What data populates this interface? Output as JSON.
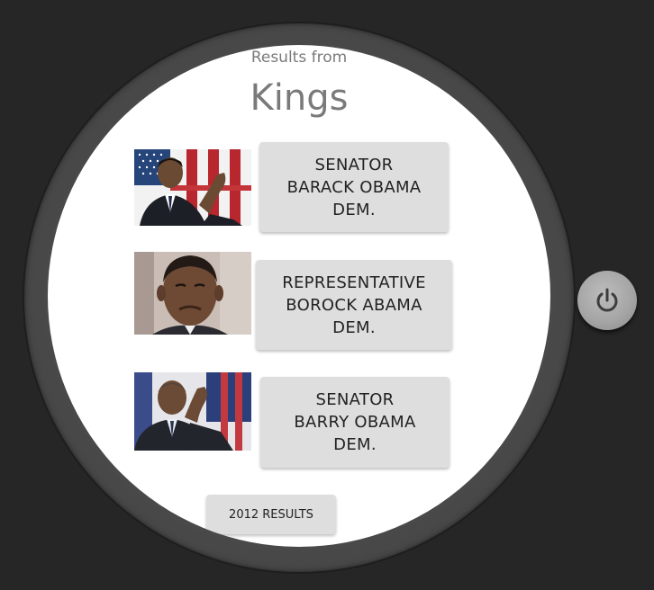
{
  "header": {
    "results_from": "Results from",
    "district": "Kings"
  },
  "representatives": [
    {
      "label": "SENATOR\nBARACK OBAMA\nDEM.",
      "photo": "portrait-flag-background"
    },
    {
      "label": "REPRESENTATIVE\nBOROCK ABAMA\nDEM.",
      "photo": "portrait-closeup"
    },
    {
      "label": "SENATOR\nBARRY OBAMA\nDEM.",
      "photo": "portrait-flag-salute"
    }
  ],
  "footer": {
    "year_button": "2012 RESULTS"
  },
  "device": {
    "power_icon": "power-icon"
  },
  "colors": {
    "background": "#262626",
    "bezel": "#4b4b4b",
    "screen": "#ffffff",
    "button": "#dedede",
    "title_text": "#7a7a7a"
  }
}
